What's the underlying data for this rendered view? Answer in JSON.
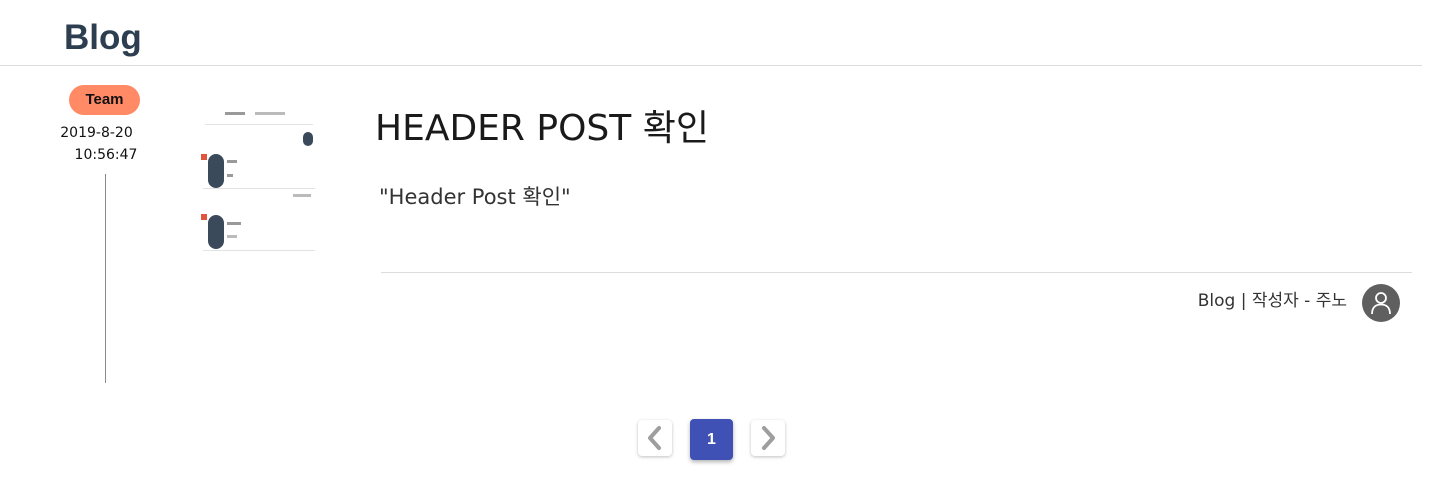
{
  "header": {
    "title": "Blog"
  },
  "post": {
    "category": "Team",
    "date": "2019-8-20",
    "time": "10:56:47",
    "thumbnail_icon": "post-thumbnail-image",
    "title": "HEADER POST 확인",
    "summary": "\"Header Post 확인\"",
    "meta": "Blog | 작성자 - 주노",
    "author_avatar_icon": "user-icon"
  },
  "pagination": {
    "prev_icon": "chevron-left-icon",
    "current_page": "1",
    "next_icon": "chevron-right-icon"
  },
  "colors": {
    "brand_title": "#2c3e50",
    "badge": "#ff8a65",
    "pager_active": "#3f51b5",
    "avatar": "#5f5f5f"
  }
}
